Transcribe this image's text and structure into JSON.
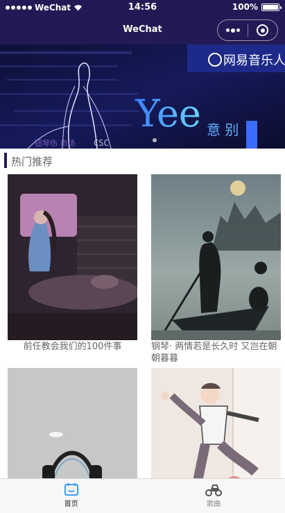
{
  "status_bar": {
    "carrier": "WeChat",
    "time": "14:56",
    "battery": "100%"
  },
  "nav": {
    "title": "WeChat"
  },
  "banner": {
    "brand": "网易音乐人",
    "headline": "Yee",
    "sub": "意 别",
    "overlay_text": "钮琴伤 市场",
    "corner_text": "CSC"
  },
  "section": {
    "title": "热门推荐"
  },
  "cards": [
    {
      "caption": "前任教会我们的100件事"
    },
    {
      "caption": "钢琴· 两情若是长久时 又岂在朝朝暮暮"
    },
    {
      "caption": ""
    },
    {
      "caption": ""
    }
  ],
  "tabbar": {
    "items": [
      {
        "label": "首页",
        "icon": "home-icon",
        "active": true
      },
      {
        "label": "歌曲",
        "icon": "scooter-icon",
        "active": false
      }
    ]
  },
  "colors": {
    "nav_bg": "#221a55",
    "accent": "#3b9cf0",
    "text_gray": "#666666"
  }
}
